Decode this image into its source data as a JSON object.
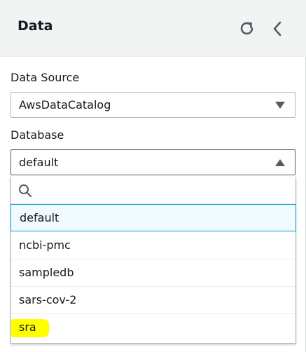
{
  "header": {
    "title": "Data"
  },
  "data_source": {
    "label": "Data Source",
    "value": "AwsDataCatalog"
  },
  "database": {
    "label": "Database",
    "value": "default",
    "search_placeholder": "",
    "options": [
      {
        "label": "default",
        "selected": true
      },
      {
        "label": "ncbi-pmc",
        "selected": false
      },
      {
        "label": "sampledb",
        "selected": false
      },
      {
        "label": "sars-cov-2",
        "selected": false
      },
      {
        "label": "sra",
        "selected": false,
        "highlighted": true
      }
    ]
  },
  "colors": {
    "header_bg": "#f2f3f3",
    "border": "#aab7b8",
    "selected_bg": "#f1faff",
    "selected_border": "#00a1c9",
    "highlight": "#ffff00",
    "text": "#16191f"
  },
  "icons": {
    "refresh": "refresh-icon",
    "collapse": "chevron-left-icon",
    "data_source_caret": "caret-down-icon",
    "database_caret": "caret-up-icon",
    "search": "search-icon"
  }
}
